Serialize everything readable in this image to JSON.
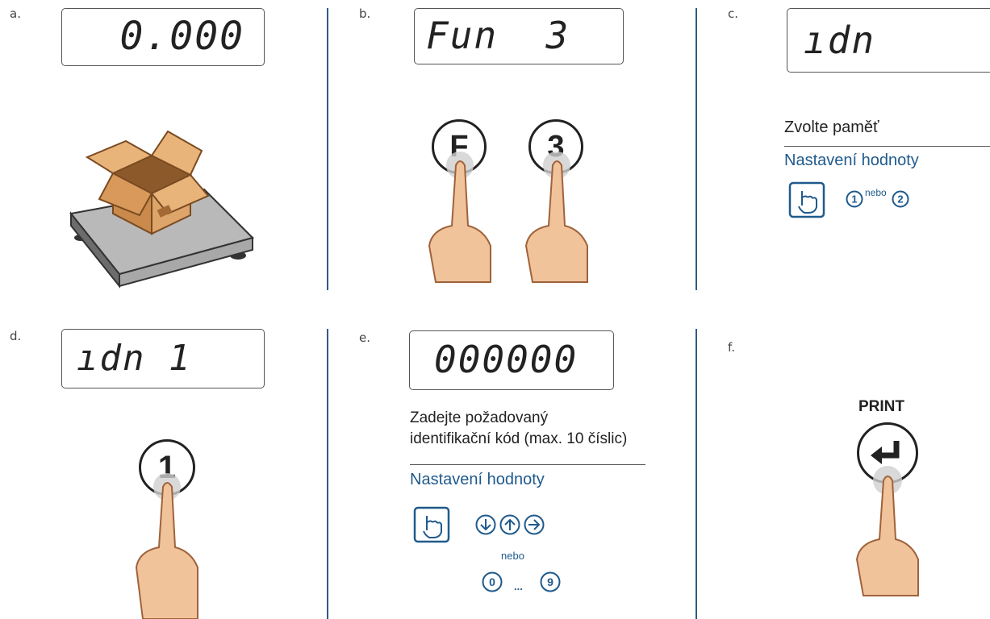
{
  "panels": {
    "a": {
      "step": "a.",
      "display": "0.000"
    },
    "b": {
      "step": "b.",
      "display": "Fun  3",
      "key1": "F",
      "key2": "3"
    },
    "c": {
      "step": "c.",
      "display": "ıdn",
      "instruction": "Zvolte paměť",
      "subheading": "Nastavení hodnoty",
      "key1": "1",
      "or": "nebo",
      "key2": "2"
    },
    "d": {
      "step": "d.",
      "display": "ıdn 1",
      "key": "1"
    },
    "e": {
      "step": "e.",
      "display": "000000",
      "instruction_line1": "Zadejte požadovaný",
      "instruction_line2": "identifikační kód (max. 10 číslic)",
      "subheading": "Nastavení hodnoty",
      "or": "nebo",
      "key_first": "0",
      "ellipsis": "...",
      "key_last": "9"
    },
    "f": {
      "step": "f.",
      "key_label": "PRINT"
    }
  },
  "colors": {
    "accent": "#1f5a8c",
    "separator": "#2f5b86",
    "finger": "#f0c39b",
    "finger_outline": "#a0623a",
    "box": "#d9a066"
  },
  "icons": {
    "arrow_down": "arrow-down-circle",
    "arrow_up": "arrow-up-circle",
    "arrow_right": "arrow-right-circle",
    "enter": "enter-icon",
    "touch": "touch-icon"
  }
}
